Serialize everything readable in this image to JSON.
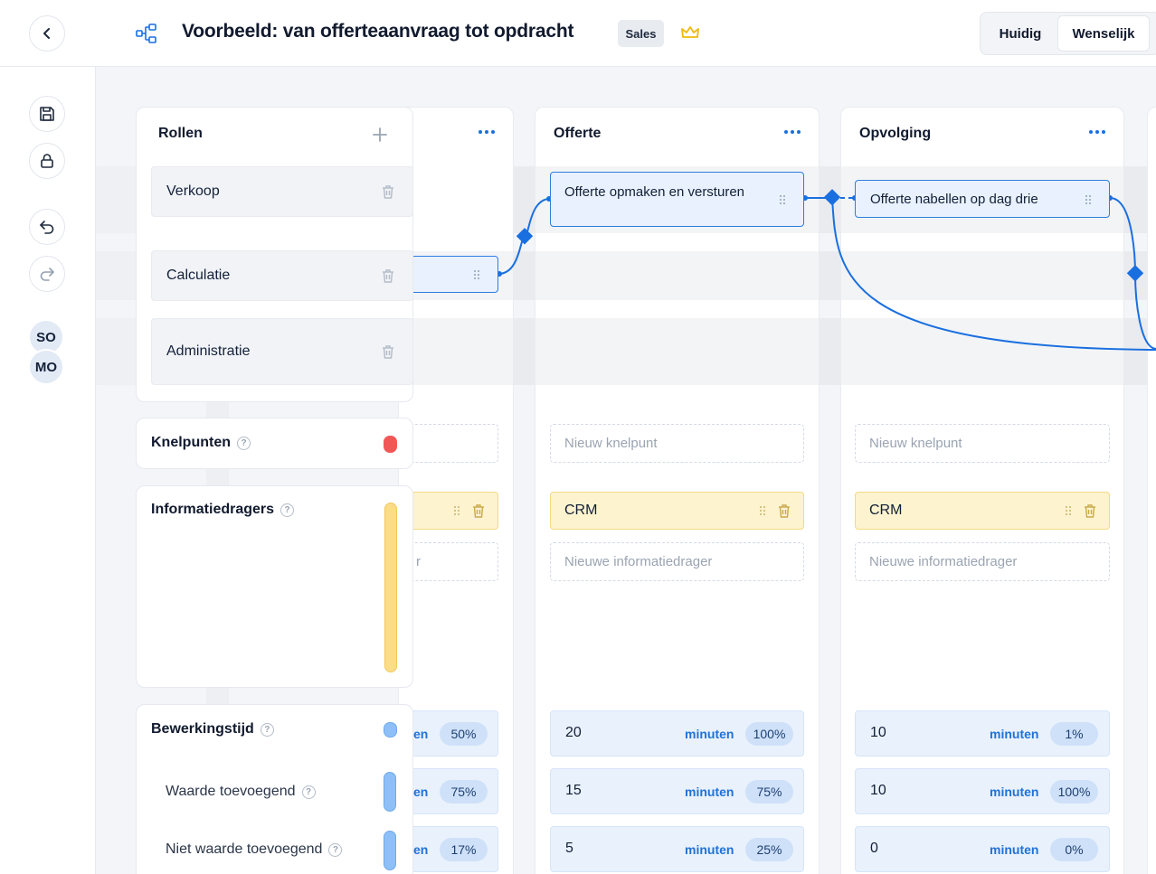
{
  "header": {
    "title": "Voorbeeld: van offerteaanvraag tot opdracht",
    "badge": "Sales",
    "toggle": {
      "current": "Huidig",
      "desired": "Wenselijk"
    }
  },
  "sidebar": {
    "avatars": [
      "SO",
      "MO"
    ]
  },
  "roles_panel": {
    "title": "Rollen",
    "roles": [
      "Verkoop",
      "Calculatie",
      "Administratie"
    ]
  },
  "sections": {
    "knelpunten": "Knelpunten",
    "informatiedragers": "Informatiedragers",
    "bewerkingstijd": "Bewerkingstijd",
    "waarde": "Waarde toevoegend",
    "niet_waarde": "Niet waarde toevoegend",
    "help_glyph": "?"
  },
  "columns": [
    {
      "title": "",
      "task": "",
      "knelpunt_placeholder": "",
      "info_carrier": "",
      "info_placeholder": "r",
      "times": [
        {
          "value": "",
          "unit": "en",
          "pct": "50%"
        },
        {
          "value": "",
          "unit": "en",
          "pct": "75%"
        },
        {
          "value": "",
          "unit": "en",
          "pct": "17%"
        }
      ]
    },
    {
      "title": "Offerte",
      "task": "Offerte opmaken en versturen",
      "knelpunt_placeholder": "Nieuw knelpunt",
      "info_carrier": "CRM",
      "info_placeholder": "Nieuwe informatiedrager",
      "times": [
        {
          "value": "20",
          "unit": "minuten",
          "pct": "100%"
        },
        {
          "value": "15",
          "unit": "minuten",
          "pct": "75%"
        },
        {
          "value": "5",
          "unit": "minuten",
          "pct": "25%"
        }
      ]
    },
    {
      "title": "Opvolging",
      "task": "Offerte nabellen op dag drie",
      "knelpunt_placeholder": "Nieuw knelpunt",
      "info_carrier": "CRM",
      "info_placeholder": "Nieuwe informatiedrager",
      "times": [
        {
          "value": "10",
          "unit": "minuten",
          "pct": "1%"
        },
        {
          "value": "10",
          "unit": "minuten",
          "pct": "100%"
        },
        {
          "value": "0",
          "unit": "minuten",
          "pct": "0%"
        }
      ]
    }
  ],
  "colors": {
    "accent": "#1a6fe0",
    "knelpunt_dot": "#f25757",
    "info_pill": "#fbdc87",
    "time_pill": "#8ec0f7"
  },
  "icons": [
    "chevron-left-icon",
    "process-flow-icon",
    "crown-icon",
    "save-icon",
    "lock-icon",
    "undo-icon",
    "redo-icon",
    "plus-icon",
    "trash-icon",
    "drag-handle-icon",
    "more-dots-icon",
    "help-icon"
  ]
}
